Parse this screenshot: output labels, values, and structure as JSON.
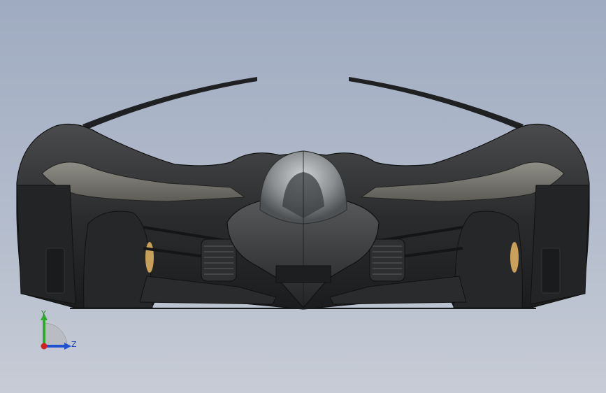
{
  "viewport": {
    "background_top": "#9fabc1",
    "background_bottom": "#c7ccd6"
  },
  "model": {
    "icon": "racecar-model-front-view",
    "body_color": "#2a2b2c",
    "canopy_color": "#8d9194",
    "accent_color": "#c9a05a"
  },
  "triad": {
    "y_label": "Y",
    "z_label": "Z",
    "y_color": "#2faa2f",
    "z_color": "#2050d0",
    "x_color": "#d02020"
  }
}
